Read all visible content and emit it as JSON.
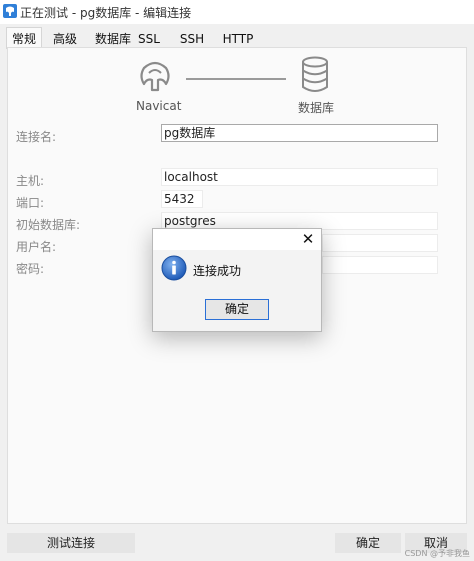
{
  "window": {
    "title": "正在测试 - pg数据库 - 编辑连接"
  },
  "tabs": [
    {
      "label": "常规",
      "active": true
    },
    {
      "label": "高级"
    },
    {
      "label": "数据库"
    },
    {
      "label": "SSL"
    },
    {
      "label": "SSH"
    },
    {
      "label": "HTTP"
    }
  ],
  "header": {
    "left_label": "Navicat",
    "right_label": "数据库"
  },
  "form": {
    "connection_name": {
      "label": "连接名:",
      "value": "pg数据库"
    },
    "host": {
      "label": "主机:",
      "value": "localhost"
    },
    "port": {
      "label": "端口:",
      "value": "5432"
    },
    "initial_db": {
      "label": "初始数据库:",
      "value": "postgres"
    },
    "username": {
      "label": "用户名:",
      "value": ""
    },
    "password": {
      "label": "密码:",
      "value": ""
    }
  },
  "dialog": {
    "message": "连接成功",
    "ok_label": "确定",
    "close_symbol": "✕",
    "icon": "info-icon"
  },
  "footer": {
    "test_label": "测试连接",
    "ok_label": "确定",
    "cancel_label": "取消"
  },
  "watermark": "CSDN @予非我鱼",
  "colors": {
    "accent": "#2a6fd6",
    "info_icon": "#1f5bb8"
  }
}
